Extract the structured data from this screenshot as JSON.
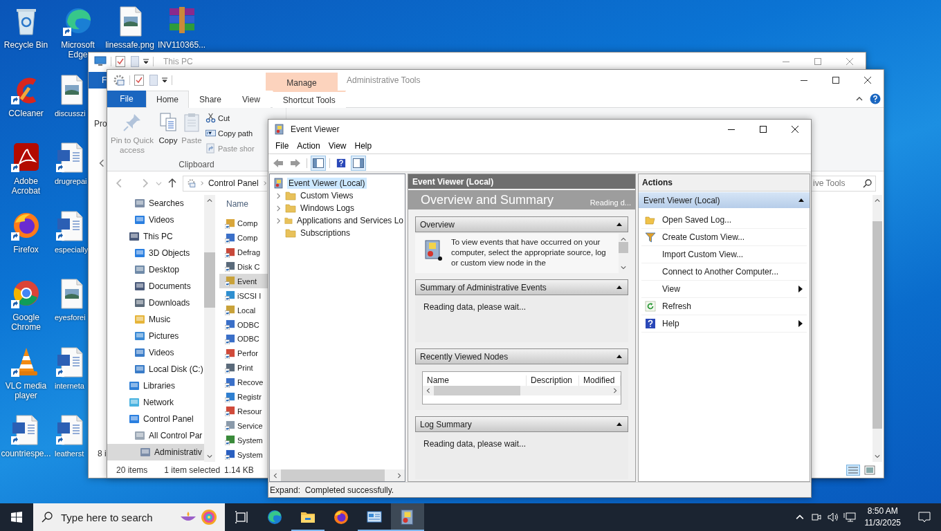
{
  "desktop": {
    "icons": [
      {
        "label": "Recycle Bin"
      },
      {
        "label": "CCleaner"
      },
      {
        "label": "Adobe Acrobat"
      },
      {
        "label": "Firefox"
      },
      {
        "label": "Google Chrome"
      },
      {
        "label": "VLC media player"
      },
      {
        "label": "countriespe..."
      },
      {
        "label": "Microsoft Edge"
      },
      {
        "label": "discusszi"
      },
      {
        "label": "drugrepai"
      },
      {
        "label": "especially"
      },
      {
        "label": "eyesforei"
      },
      {
        "label": "interneta"
      },
      {
        "label": "leatherst"
      },
      {
        "label": "linessafe.png"
      },
      {
        "label": "INV110365..."
      }
    ]
  },
  "this_pc_window": {
    "title": "This PC",
    "file_tab": "F",
    "ribbon_text": "Pro",
    "status": "8 i"
  },
  "explorer_window": {
    "title": "Administrative Tools",
    "context_group": "Manage",
    "file_tab": "File",
    "tabs": [
      {
        "label": "Home",
        "kind": "standard",
        "selected": true
      },
      {
        "label": "Share",
        "kind": "standard",
        "selected": false
      },
      {
        "label": "View",
        "kind": "standard",
        "selected": false
      },
      {
        "label": "Shortcut Tools",
        "kind": "contextual",
        "selected": false
      }
    ],
    "ribbon": {
      "large_buttons": [
        {
          "label": "Pin to Quick access",
          "disabled": true
        },
        {
          "label": "Copy",
          "disabled": false
        },
        {
          "label": "Paste",
          "disabled": true
        }
      ],
      "small_buttons": [
        {
          "label": "Cut",
          "disabled": false
        },
        {
          "label": "Copy path",
          "disabled": false
        },
        {
          "label": "Paste shor",
          "disabled": true
        }
      ],
      "group_label": "Clipboard"
    },
    "address": {
      "segment": "Control Panel"
    },
    "search": {
      "placeholder": "ive Tools"
    },
    "nav_pane": {
      "items": [
        {
          "children": [
            {
              "label": "Searches",
              "selected": false
            },
            {
              "label": "Videos",
              "selected": false
            }
          ]
        },
        {
          "label": "This PC",
          "selected": false,
          "children": [
            {
              "label": "3D Objects",
              "selected": false
            },
            {
              "label": "Desktop",
              "selected": false
            },
            {
              "label": "Documents",
              "selected": false
            },
            {
              "label": "Downloads",
              "selected": false
            },
            {
              "label": "Music",
              "selected": false
            },
            {
              "label": "Pictures",
              "selected": false
            },
            {
              "label": "Videos",
              "selected": false
            },
            {
              "label": "Local Disk (C:)",
              "selected": false
            }
          ]
        },
        {
          "label": "Libraries",
          "selected": false
        },
        {
          "label": "Network",
          "selected": false
        },
        {
          "label": "Control Panel",
          "selected": false,
          "children": [
            {
              "label": "All Control Par",
              "selected": false,
              "children": [
                {
                  "label": "Administrativ",
                  "selected": true
                }
              ]
            }
          ]
        }
      ]
    },
    "content": {
      "column": "Name",
      "items": [
        {
          "label": "Comp",
          "selected": false
        },
        {
          "label": "Comp",
          "selected": false
        },
        {
          "label": "Defrag",
          "selected": false
        },
        {
          "label": "Disk C",
          "selected": false
        },
        {
          "label": "Event",
          "selected": true
        },
        {
          "label": "iSCSI I",
          "selected": false
        },
        {
          "label": "Local",
          "selected": false
        },
        {
          "label": "ODBC",
          "selected": false
        },
        {
          "label": "ODBC",
          "selected": false
        },
        {
          "label": "Perfor",
          "selected": false
        },
        {
          "label": "Print",
          "selected": false
        },
        {
          "label": "Recove",
          "selected": false
        },
        {
          "label": "Registr",
          "selected": false
        },
        {
          "label": "Resour",
          "selected": false
        },
        {
          "label": "Service",
          "selected": false
        },
        {
          "label": "System",
          "selected": false
        },
        {
          "label": "System",
          "selected": false
        }
      ]
    },
    "status": {
      "count": "20 items",
      "selection": "1 item selected",
      "size": "1.14 KB"
    }
  },
  "event_viewer": {
    "title": "Event Viewer",
    "menu": [
      "File",
      "Action",
      "View",
      "Help"
    ],
    "tree": {
      "label": "Event Viewer (Local)",
      "selected": true,
      "children": [
        {
          "label": "Custom Views",
          "selected": false,
          "expandable": true
        },
        {
          "label": "Windows Logs",
          "selected": false,
          "expandable": true
        },
        {
          "label": "Applications and Services Lo",
          "selected": false,
          "expandable": true
        },
        {
          "label": "Subscriptions",
          "selected": false,
          "expandable": false
        }
      ]
    },
    "center": {
      "header": "Event Viewer (Local)",
      "title": "Overview and Summary",
      "status": "Reading d...",
      "sections": [
        {
          "kind": "overview",
          "title": "Overview",
          "expanded": true,
          "text": "To view events that have occurred on your computer, select the appropriate source, log or custom view node in the"
        },
        {
          "kind": "message",
          "title": "Summary of Administrative Events",
          "expanded": true,
          "text": "Reading data, please wait..."
        },
        {
          "kind": "table",
          "title": "Recently Viewed Nodes",
          "expanded": true,
          "columns": [
            "Name",
            "Description",
            "Modified"
          ]
        },
        {
          "kind": "message",
          "title": "Log Summary",
          "expanded": true,
          "text": "Reading data, please wait..."
        }
      ]
    },
    "actions": {
      "header": "Actions",
      "group": "Event Viewer (Local)",
      "group_expanded": true,
      "items": [
        {
          "label": "Open Saved Log...",
          "submenu": false
        },
        {
          "label": "Create Custom View...",
          "submenu": false
        },
        {
          "label": "Import Custom View...",
          "submenu": false
        },
        {
          "label": "Connect to Another Computer...",
          "submenu": false
        },
        {
          "label": "View",
          "submenu": true
        },
        {
          "label": "Refresh",
          "submenu": false
        },
        {
          "label": "Help",
          "submenu": true
        }
      ]
    },
    "status_bar": "Expand:  Completed successfully."
  },
  "taskbar": {
    "search": {
      "placeholder": "Type here to search"
    },
    "apps": [
      {
        "running": false,
        "active": false
      },
      {
        "running": true,
        "active": false
      },
      {
        "running": false,
        "active": false
      },
      {
        "running": true,
        "active": false
      },
      {
        "running": true,
        "active": true
      }
    ],
    "time": "8:50 AM",
    "date": "11/3/2025"
  }
}
